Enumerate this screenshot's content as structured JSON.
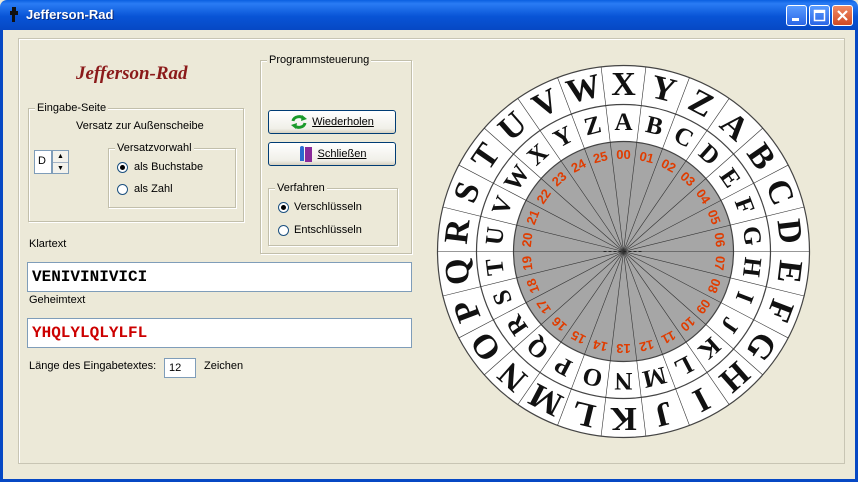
{
  "window": {
    "title": "Jefferson-Rad"
  },
  "app": {
    "heading": "Jefferson-Rad"
  },
  "input_group": {
    "legend": "Eingabe-Seite",
    "offset_label": "Versatz zur Außenscheibe",
    "offset_value": "D",
    "mode_legend": "Versatzvorwahl",
    "mode_options": [
      "als Buchstabe",
      "als Zahl"
    ],
    "mode_selected": 0
  },
  "program": {
    "legend": "Programmsteuerung",
    "repeat_label": "Wiederholen",
    "close_label": "Schließen",
    "method_legend": "Verfahren",
    "method_options": [
      "Verschlüsseln",
      "Entschlüsseln"
    ],
    "method_selected": 0
  },
  "plaintext": {
    "label": "Klartext",
    "value": "VENIVINIVICI"
  },
  "ciphertext": {
    "label": "Geheimtext",
    "value": "YHQLYLQLYLFL",
    "color": "#cc0000"
  },
  "length": {
    "label": "Länge des Eingabetextes:",
    "value": "12",
    "unit": "Zeichen"
  },
  "wheel": {
    "outer_letters": [
      "A",
      "B",
      "C",
      "D",
      "E",
      "F",
      "G",
      "H",
      "I",
      "J",
      "K",
      "L",
      "M",
      "N",
      "O",
      "P",
      "Q",
      "R",
      "S",
      "T",
      "U",
      "V",
      "W",
      "X",
      "Y",
      "Z"
    ],
    "inner_letters": [
      "A",
      "B",
      "C",
      "D",
      "E",
      "F",
      "G",
      "H",
      "I",
      "J",
      "K",
      "L",
      "M",
      "N",
      "O",
      "P",
      "Q",
      "R",
      "S",
      "T",
      "U",
      "V",
      "W",
      "X",
      "Y",
      "Z"
    ],
    "numbers": [
      "00",
      "01",
      "02",
      "03",
      "04",
      "05",
      "06",
      "07",
      "08",
      "09",
      "10",
      "11",
      "12",
      "13",
      "14",
      "15",
      "16",
      "17",
      "18",
      "19",
      "20",
      "21",
      "22",
      "23",
      "24",
      "25"
    ],
    "number_color": "#e03c00",
    "center_fill": "#a6a6a6"
  }
}
